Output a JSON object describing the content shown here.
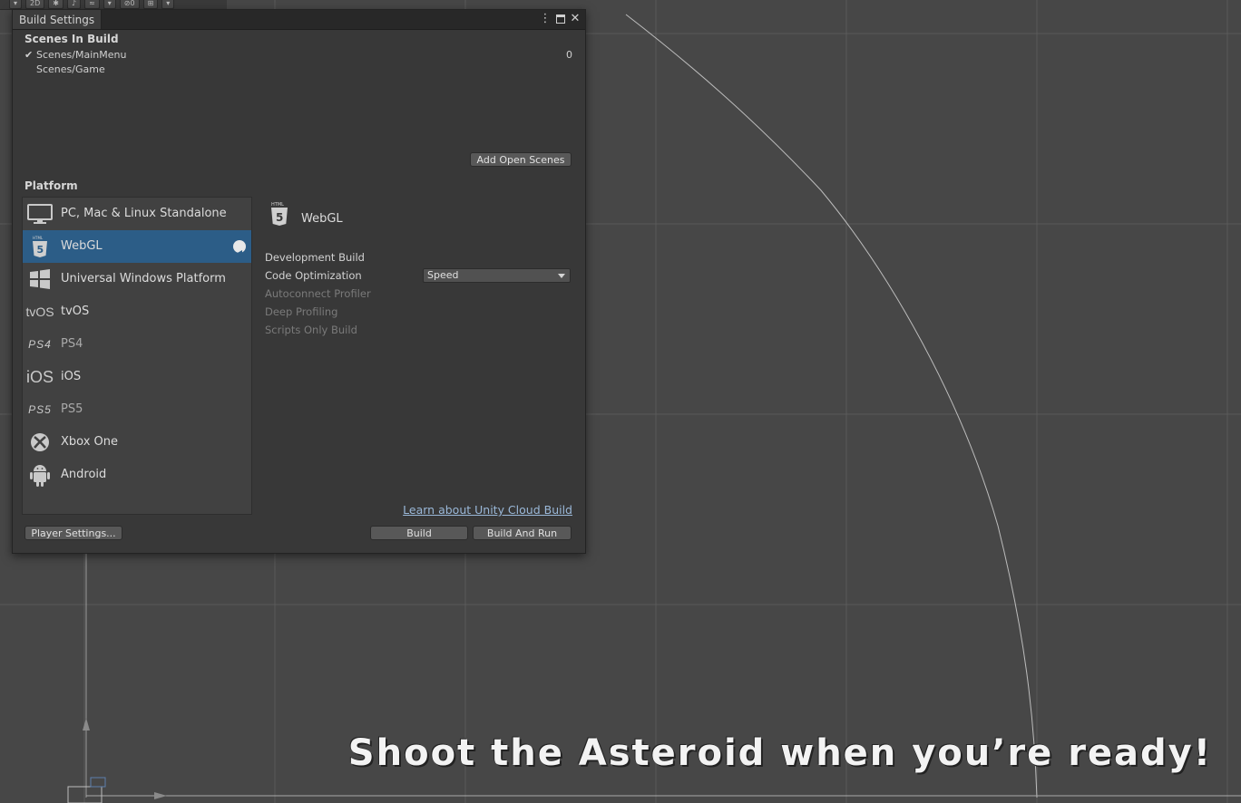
{
  "scene": {
    "toolbar": {
      "mode_label": "2D",
      "hidden_count": "0"
    },
    "banner_text": "Shoot the Asteroid when you’re ready!"
  },
  "window": {
    "title": "Build Settings",
    "scenes_header": "Scenes In Build",
    "scenes": [
      {
        "checked": true,
        "name": "Scenes/MainMenu",
        "index": "0"
      },
      {
        "checked": false,
        "name": "Scenes/Game",
        "index": ""
      }
    ],
    "add_open_scenes": "Add Open Scenes",
    "platform_header": "Platform",
    "platforms": [
      {
        "label": "PC, Mac & Linux Standalone",
        "icon": "monitor-icon"
      },
      {
        "label": "WebGL",
        "icon": "html5-icon",
        "selected": true
      },
      {
        "label": "Universal Windows Platform",
        "icon": "windows-icon"
      },
      {
        "label": "tvOS",
        "icon": "tvos-icon",
        "logo_text": "tvOS"
      },
      {
        "label": "PS4",
        "icon": "ps4-icon",
        "logo_text": "PS4"
      },
      {
        "label": "iOS",
        "icon": "ios-icon",
        "logo_text": "iOS"
      },
      {
        "label": "PS5",
        "icon": "ps5-icon",
        "logo_text": "PS5"
      },
      {
        "label": "Xbox One",
        "icon": "xbox-icon"
      },
      {
        "label": "Android",
        "icon": "android-icon"
      }
    ],
    "settings": {
      "platform_title": "WebGL",
      "development_build": "Development Build",
      "code_optimization_label": "Code Optimization",
      "code_optimization_value": "Speed",
      "autoconnect_profiler": "Autoconnect Profiler",
      "deep_profiling": "Deep Profiling",
      "scripts_only_build": "Scripts Only Build"
    },
    "cloud_build_link": "Learn about Unity Cloud Build",
    "player_settings": "Player Settings...",
    "build": "Build",
    "build_and_run": "Build And Run"
  },
  "colors": {
    "window_bg": "#383838",
    "selection": "#2c5d87",
    "scene_bg": "#474747",
    "link": "#9ab8d8"
  }
}
